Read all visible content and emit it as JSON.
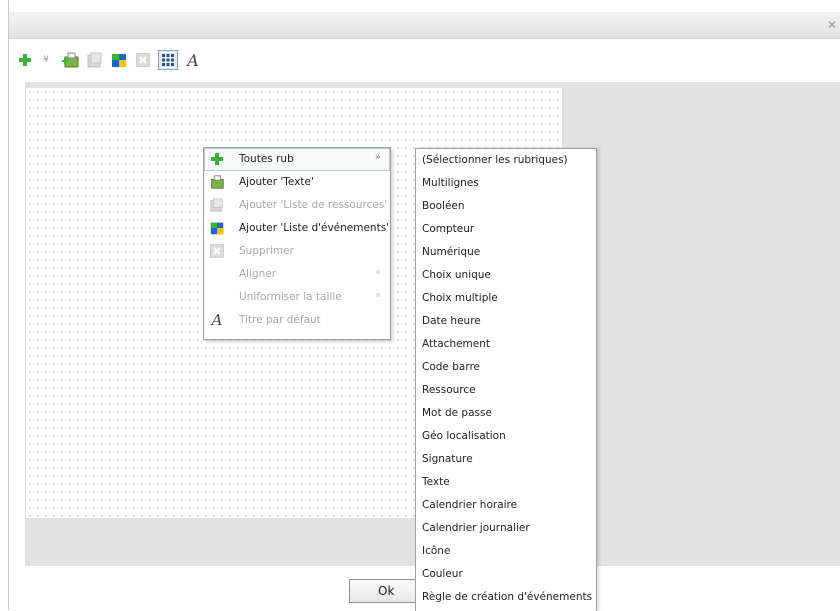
{
  "toolbar": {
    "icons": [
      "add-icon",
      "dropdown-arrow-icon",
      "add-text-icon",
      "add-resource-list-icon",
      "add-event-list-icon",
      "delete-icon",
      "grid-icon",
      "italic-title-icon"
    ]
  },
  "context_menu": {
    "items": [
      {
        "label": "Toutes rub",
        "enabled": true,
        "submenu": true
      },
      {
        "label": "Ajouter 'Texte'",
        "enabled": true,
        "submenu": false
      },
      {
        "label": "Ajouter 'Liste de ressources'",
        "enabled": false,
        "submenu": false
      },
      {
        "label": "Ajouter 'Liste d'événements'",
        "enabled": true,
        "submenu": false
      },
      {
        "label": "Supprimer",
        "enabled": false,
        "submenu": false
      },
      {
        "label": "Aligner",
        "enabled": false,
        "submenu": true
      },
      {
        "label": "Uniformiser la taille",
        "enabled": false,
        "submenu": true
      },
      {
        "label": "Titre par défaut",
        "enabled": false,
        "submenu": false
      }
    ],
    "arrow": "»"
  },
  "submenu": {
    "items": [
      "(Sélectionner les rubriques)",
      "Multilignes",
      "Booléen",
      "Compteur",
      "Numérique",
      "Choix unique",
      "Choix multiple",
      "Date heure",
      "Attachement",
      "Code barre",
      "Ressource",
      "Mot de passe",
      "Géo localisation",
      "Signature",
      "Texte",
      "Calendrier horaire",
      "Calendrier journalier",
      "Icône",
      "Couleur",
      "Règle de création d'événements"
    ]
  },
  "footer": {
    "ok_label": "Ok"
  },
  "colors": {
    "menu_border": "#a0a0a0",
    "disabled_text": "#a8a8a8",
    "workspace_bg": "#e2e2e2"
  }
}
